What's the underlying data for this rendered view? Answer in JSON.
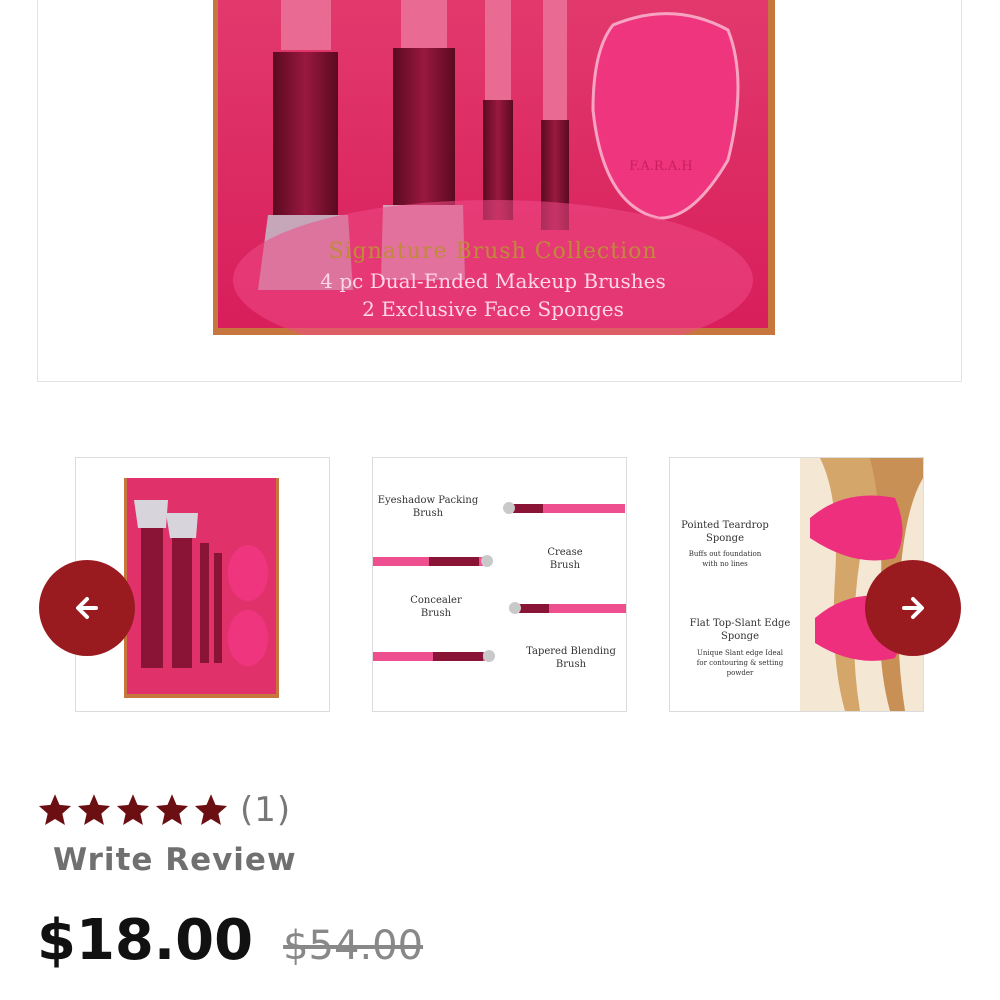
{
  "gallery": {
    "main_image": {
      "alt": "Signature Brush Collection package",
      "headline": "Signature Brush Collection",
      "line1": "4 pc Dual-Ended Makeup Brushes",
      "line2": "2 Exclusive Face Sponges",
      "brand": "F.A.R.A.H"
    },
    "thumbs": [
      {
        "name": "Signature Brush Collection box"
      },
      {
        "name": "Brush guide",
        "labels": [
          "Eyeshadow Packing",
          "Brush",
          "Crease",
          "Brush",
          "Concealer",
          "Brush",
          "Tapered Blending",
          "Brush"
        ]
      },
      {
        "name": "Sponge guide",
        "labels": [
          "Pointed Teardrop",
          "Sponge",
          "Buffs out foundation",
          "with no lines",
          "Flat Top-Slant Edge",
          "Sponge",
          "Unique Slant edge Ideal",
          "for contouring & setting",
          "powder"
        ]
      }
    ],
    "prev_icon": "arrow-left-icon",
    "next_icon": "arrow-right-icon",
    "accent_color": "#9a1b1f"
  },
  "rating": {
    "stars": 5,
    "count": "(1)",
    "star_color": "#6b0f12",
    "write_review": "Write Review"
  },
  "price": {
    "sale": "$18.00",
    "original": "$54.00"
  }
}
